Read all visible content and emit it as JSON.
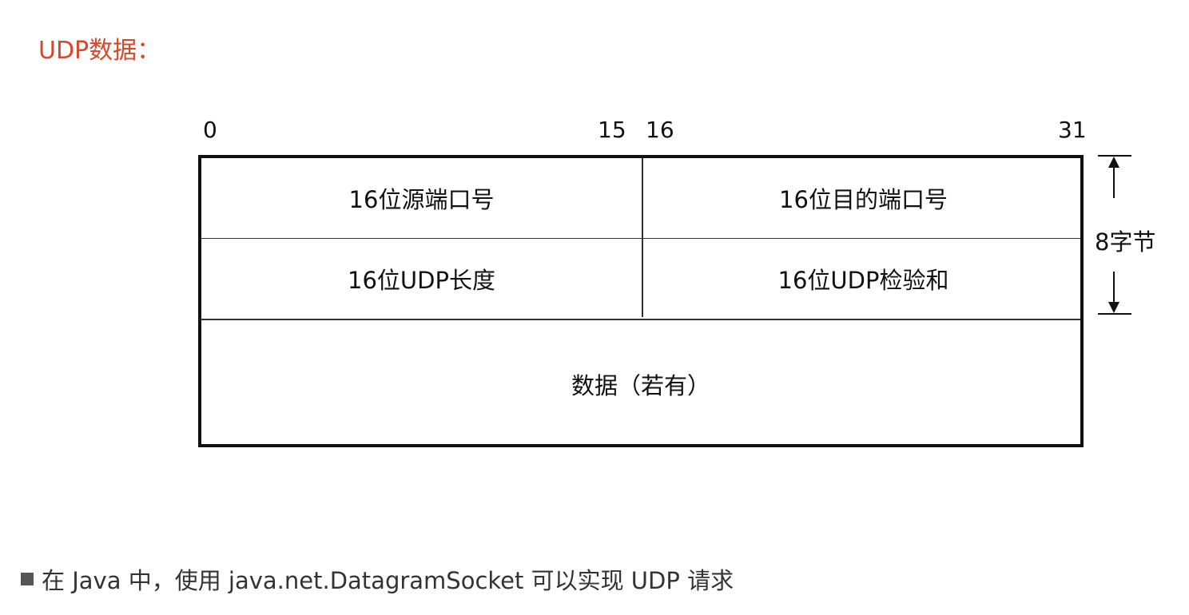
{
  "heading": "UDP数据：",
  "diagram": {
    "bit_labels": {
      "start": "0",
      "mid_end": "15",
      "mid_start": "16",
      "end": "31"
    },
    "fields": {
      "source_port": "16位源端口号",
      "dest_port": "16位目的端口号",
      "length": "16位UDP长度",
      "checksum": "16位UDP检验和",
      "data": "数据（若有）"
    },
    "header_size_label": "8字节"
  },
  "note": {
    "text": "在 Java 中，使用 java.net.DatagramSocket 可以实现 UDP 请求"
  },
  "colors": {
    "heading": "#d9472b",
    "border": "#111111",
    "note_text": "#333333"
  }
}
